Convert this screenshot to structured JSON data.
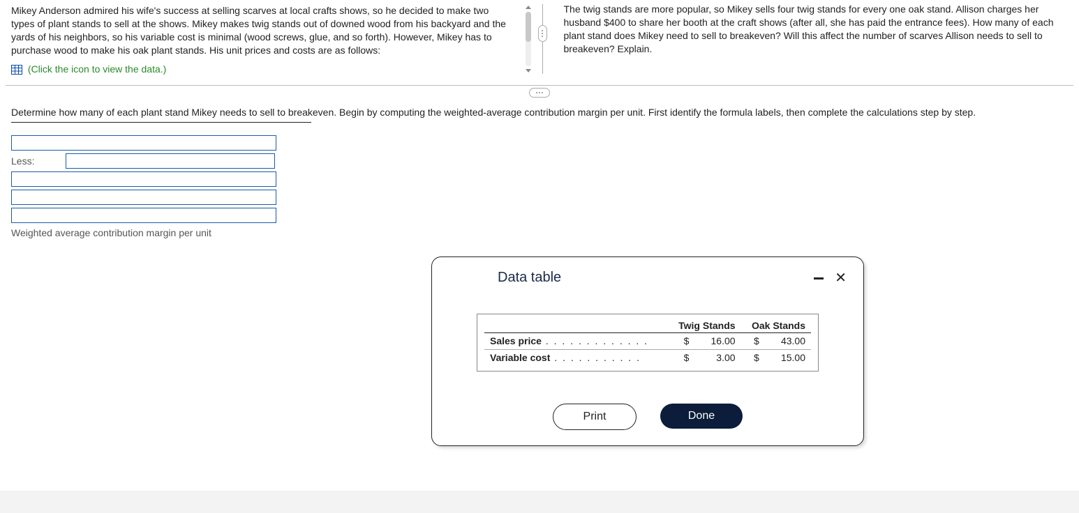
{
  "question": {
    "left_text": "Mikey Anderson admired his wife's success at selling scarves at local crafts shows, so he decided to make two types of plant stands to sell at the shows. Mikey makes twig stands out of downed wood from his backyard and the yards of his neighbors, so his variable cost is minimal (wood screws, glue, and so forth). However, Mikey has to purchase wood to make his oak plant stands. His unit prices and costs are as follows:",
    "icon_link_text": "(Click the icon to view the data.)",
    "right_text": "The twig stands are more popular, so Mikey sells four twig stands for every one oak stand. Allison charges her husband $400 to share her booth at the craft shows (after all, she has paid the entrance fees). How many of each plant stand does Mikey need to sell to breakeven? Will this affect the number of scarves Allison needs to sell to breakeven? Explain."
  },
  "instruction": "Determine how many of each plant stand Mikey needs to sell to breakeven. Begin by computing the weighted-average contribution margin per unit. First identify the formula labels, then complete the calculations step by step.",
  "formula": {
    "less_label": "Less:",
    "result_label": "Weighted average contribution margin per unit",
    "inputs": {
      "r1": "",
      "r2_less": "",
      "r3": "",
      "r4": "",
      "r5": ""
    }
  },
  "dialog": {
    "title": "Data table",
    "print": "Print",
    "done": "Done",
    "table": {
      "col1": "Twig Stands",
      "col2": "Oak Stands",
      "currency": "$",
      "rows": [
        {
          "label": "Sales price",
          "v1": "16.00",
          "v2": "43.00"
        },
        {
          "label": "Variable cost",
          "v1": "3.00",
          "v2": "15.00"
        }
      ]
    }
  }
}
